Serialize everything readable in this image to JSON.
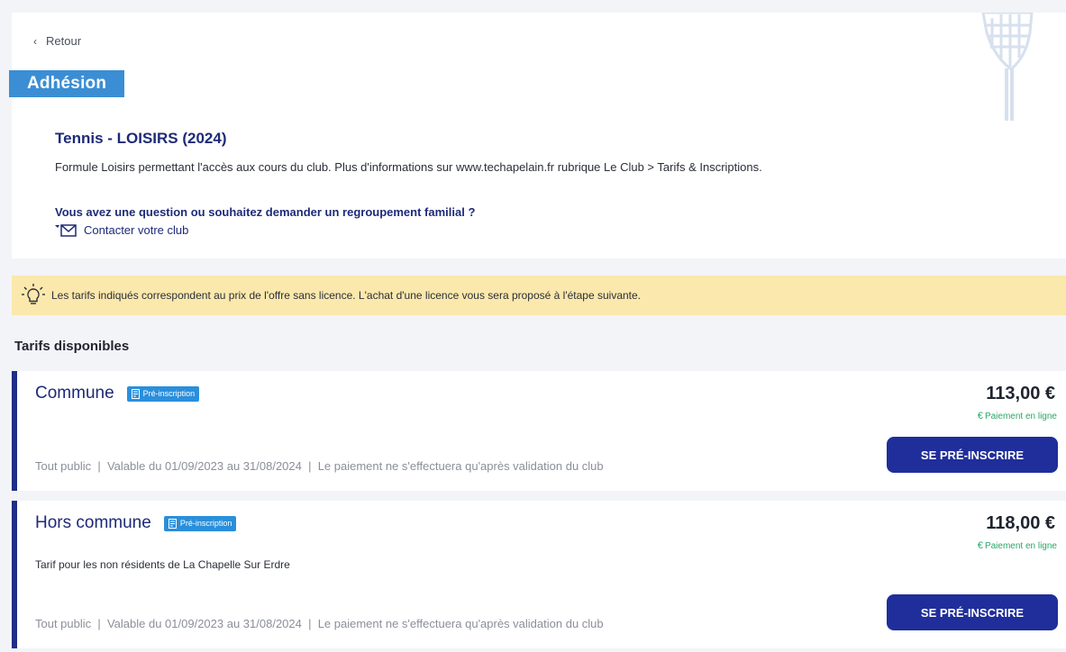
{
  "nav": {
    "back_label": "Retour"
  },
  "header": {
    "tag": "Adhésion",
    "offer_title": "Tennis - LOISIRS (2024)",
    "offer_description": "Formule Loisirs permettant l'accès aux cours du club. Plus d'informations sur www.techapelain.fr rubrique Le Club > Tarifs & Inscriptions.",
    "question": "Vous avez une question ou souhaitez demander un regroupement familial ?",
    "contact_label": "Contacter votre club"
  },
  "banner": {
    "text": "Les tarifs indiqués correspondent au prix de l'offre sans licence. L'achat d'une licence vous sera proposé à l'étape suivante."
  },
  "tarifs": {
    "section_title": "Tarifs disponibles",
    "items": [
      {
        "name": "Commune",
        "badge": "Pré-inscription",
        "price": "113,00 €",
        "payment": "Paiement en ligne",
        "meta": "Tout public  |  Valable du 01/09/2023 au 31/08/2024  |  Le paiement ne s'effectuera qu'après validation du club",
        "cta": "SE PRÉ-INSCRIRE"
      },
      {
        "name": "Hors commune",
        "badge": "Pré-inscription",
        "price": "118,00 €",
        "payment": "Paiement en ligne",
        "subtitle": "Tarif pour les non résidents de La Chapelle Sur Erdre",
        "meta": "Tout public  |  Valable du 01/09/2023 au 31/08/2024  |  Le paiement ne s'effectuera qu'après validation du club",
        "cta": "SE PRÉ-INSCRIRE"
      }
    ]
  },
  "colors": {
    "primary": "#1f2e9a",
    "tag": "#3b8ed4",
    "badge": "#2a8fdb",
    "banner": "#fbe8ac",
    "payment": "#2aa867"
  },
  "icons": [
    "chevron-left-icon",
    "tennis-racket-icon",
    "mail-icon",
    "lightbulb-icon",
    "form-icon",
    "euro-icon"
  ]
}
